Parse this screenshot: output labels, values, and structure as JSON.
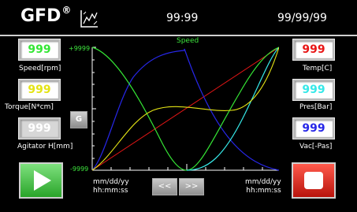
{
  "header": {
    "logo_text": "GFD",
    "logo_mark": "®",
    "time": "99:99",
    "date": "99/99/99"
  },
  "left_panel": {
    "speed": {
      "value": "999",
      "label": "Speed[rpm]"
    },
    "torque": {
      "value": "999",
      "label": "Torque[N*cm]"
    },
    "agitator": {
      "value": "999",
      "label": "Agitator H[mm]"
    }
  },
  "right_panel": {
    "temp": {
      "value": "999",
      "label": "Temp[C]"
    },
    "pres": {
      "value": "999",
      "label": "Pres[Bar]"
    },
    "vac": {
      "value": "999",
      "label": "Vac[-Pas]"
    }
  },
  "chart": {
    "series_label": "Speed",
    "y_max_label": "+9999",
    "y_min_label": "-9999",
    "start_date": "mm/dd/yy",
    "start_time": "hh:mm:ss",
    "end_date": "mm/dd/yy",
    "end_time": "hh:mm:ss"
  },
  "controls": {
    "g_button": "G",
    "prev_label": "<<",
    "next_label": ">>"
  },
  "colors": {
    "green": "#35e635",
    "yellow": "#e4e415",
    "red": "#e81616",
    "cyan": "#36e8e8",
    "blue": "#2727e8"
  }
}
